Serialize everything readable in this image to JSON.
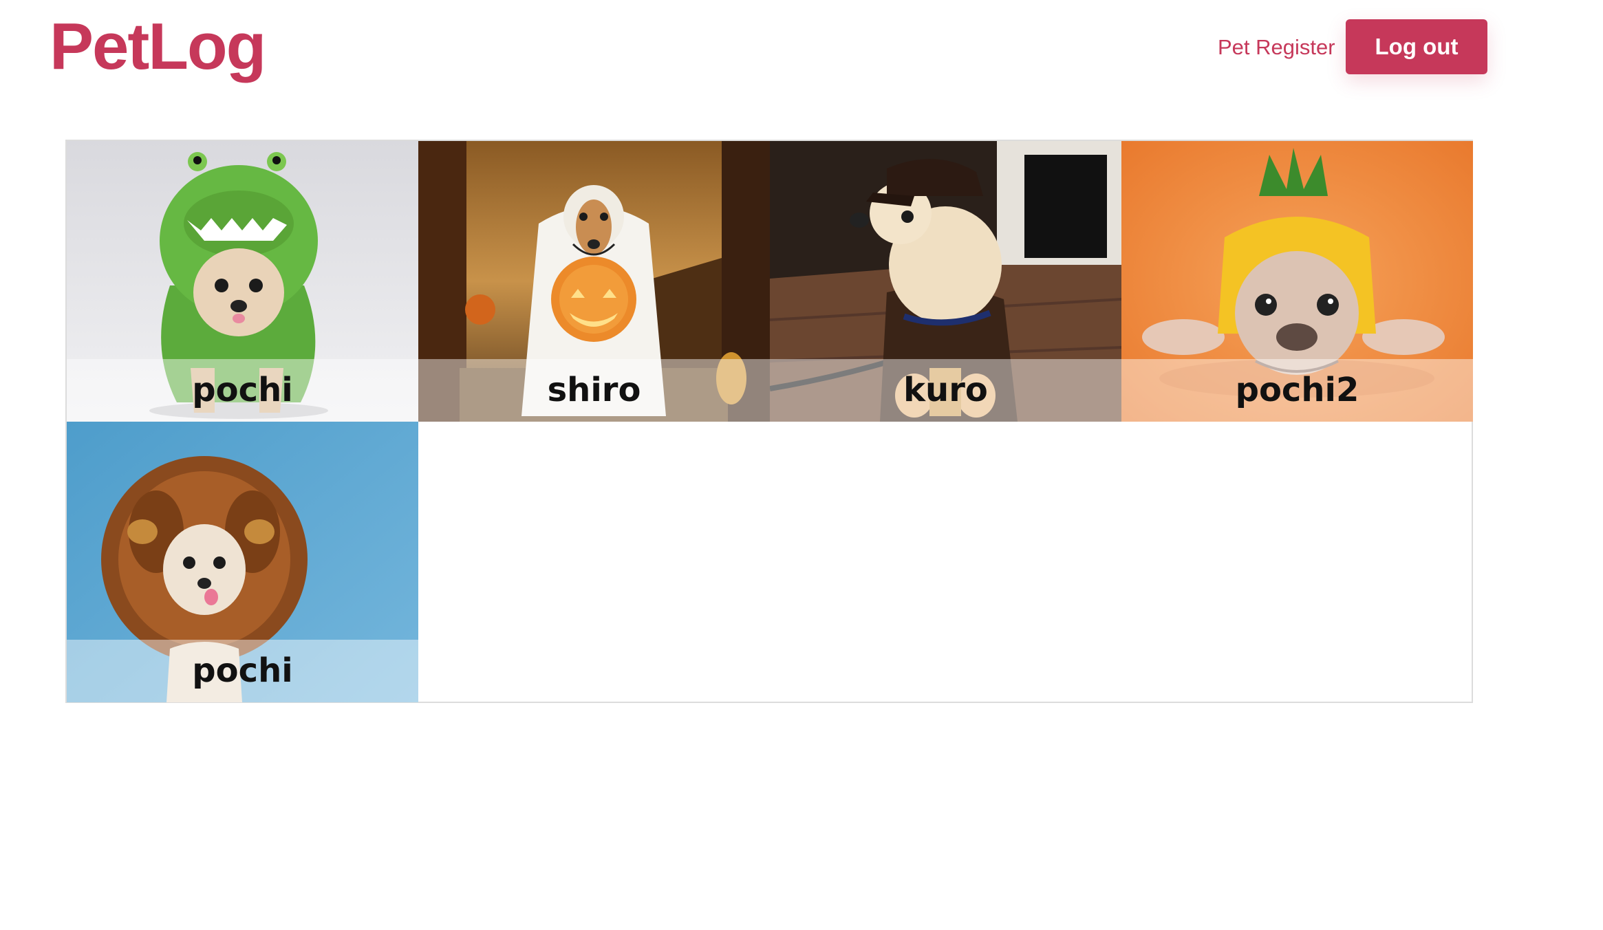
{
  "header": {
    "logo": "PetLog",
    "nav_link": "Pet Register",
    "logout_label": "Log out"
  },
  "pets": [
    {
      "name": "pochi"
    },
    {
      "name": "shiro"
    },
    {
      "name": "kuro"
    },
    {
      "name": "pochi2"
    },
    {
      "name": "pochi"
    }
  ],
  "colors": {
    "brand": "#c6385a",
    "border": "#dcdcdc"
  }
}
